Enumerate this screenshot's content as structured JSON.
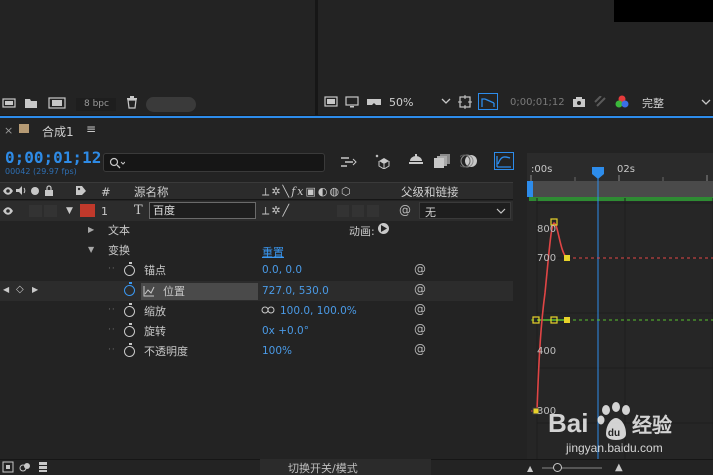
{
  "project_panel": {
    "bpc_label": "8 bpc",
    "icons": [
      "interpret-footage-icon",
      "folder-icon",
      "new-composition-icon",
      "trash-icon"
    ]
  },
  "viewer": {
    "zoom_value": "50%",
    "timecode": "0;00;01;12",
    "resolution_value": "完整"
  },
  "composition": {
    "tab_name": "合成1",
    "timecode": "0;00;01;12",
    "frame_info": "00042 (29.97 fps)",
    "search_placeholder": ""
  },
  "columns": {
    "hash": "#",
    "source_name": "源名称",
    "parent_link": "父级和链接"
  },
  "layer": {
    "number": "1",
    "type_glyph": "T",
    "name": "百度",
    "parent_value": "无",
    "label_color": "#c0392b"
  },
  "properties": {
    "text_group": "文本",
    "animate_label": "动画:",
    "transform_group": "变换",
    "reset_label": "重置",
    "anchor_label": "锚点",
    "anchor_value": "0.0, 0.0",
    "position_label": "位置",
    "position_value": "727.0, 530.0",
    "scale_label": "缩放",
    "scale_value": "100.0, 100.0%",
    "rotation_label": "旋转",
    "rotation_value": "0x +0.0°",
    "opacity_label": "不透明度",
    "opacity_value": "100%"
  },
  "graph_editor": {
    "ruler_start": ":00s",
    "ruler_mark": "02s",
    "y_labels": [
      "800",
      "700",
      "400",
      "300"
    ],
    "curve_color": "#e04545",
    "dashed_red_color": "#e04545",
    "dashed_green_color": "#58c22e",
    "keyframe_color": "#e8d22a"
  },
  "bottom_bar": {
    "toggle_label": "切换开关/模式"
  },
  "watermark": {
    "text": "Baidu 经验",
    "url": "jingyan.baidu.com"
  }
}
